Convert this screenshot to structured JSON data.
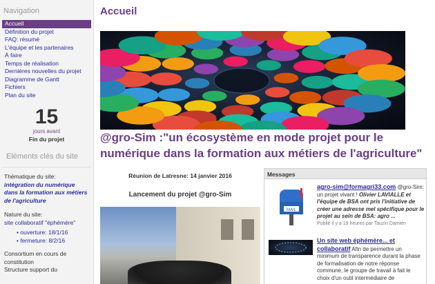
{
  "sidebar": {
    "nav_title": "Navigation",
    "nav_items": [
      "Accueil",
      "Définition du projet",
      "FAQ: résumé",
      "L'équipe et les partenaires",
      "À faire",
      "Temps de réalisation",
      "Dernières nouvelles du projet",
      "Diagramme de Gantt",
      "Fichiers",
      "Plan du site"
    ],
    "countdown": {
      "number": "15",
      "label1": "jours avant",
      "label2": "Fin du projet"
    },
    "key_title": "Eléments clés du site",
    "theme_label": "Thématique du site:",
    "theme_value": "intégration du numérique dans la formation aux métiers de l'agriculture",
    "nature_label": "Nature du site:",
    "nature_value": "site collaboratif \"éphémère\"",
    "opening": "ouverture: 18/1/16",
    "closing": "fermeture: 8/2/16",
    "consortium": "Consortium en cours de constitution",
    "structure": "Structure support du"
  },
  "main": {
    "title": "Accueil",
    "headline": "@gro-Sim :\"un écosystème en mode projet pour le numérique dans la formation aux métiers de l'agriculture\"",
    "meeting": "Réunion de Latresne: 14 janvier 2016",
    "launch": "Lancement du projet @gro-Sim"
  },
  "messages": {
    "header": "Messages",
    "item1": {
      "title": "agro-sim@formagri33.com",
      "text_pre": "@gro-Sim: un projet vivant !",
      "text_italic": "Olivier LAVIALLE et l'équipe de BSA ont pris l'initiative de créer une adresse mel spécifique pour le projet au sein de BSA: agro ...",
      "meta": "Publié il y a 19 heures par Tauzin Damien"
    },
    "item2": {
      "title": "Un site web éphémère... et collaboratif",
      "text": "Afin de permettre un minimum de transparence durant la phase de formalisation de notre réponse commune, le groupe de travail à fait le choix d'un outil intermédiaire de"
    }
  }
}
